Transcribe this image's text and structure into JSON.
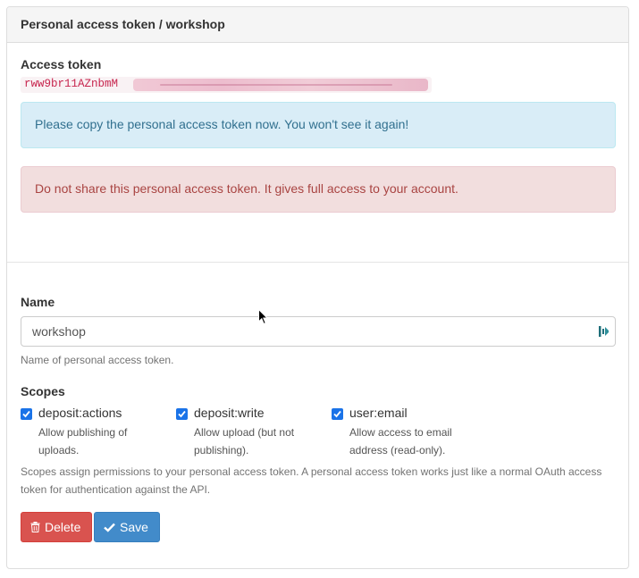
{
  "panel": {
    "title": "Personal access token / workshop"
  },
  "token": {
    "label": "Access token",
    "visible_prefix": "rww9br11AZnbmM"
  },
  "alerts": {
    "info": "Please copy the personal access token now. You won't see it again!",
    "danger": "Do not share this personal access token. It gives full access to your account."
  },
  "name_field": {
    "label": "Name",
    "value": "workshop",
    "help": "Name of personal access token."
  },
  "scopes": {
    "label": "Scopes",
    "items": [
      {
        "name": "deposit:actions",
        "desc": "Allow publishing of uploads.",
        "checked": true
      },
      {
        "name": "deposit:write",
        "desc": "Allow upload (but not publishing).",
        "checked": true
      },
      {
        "name": "user:email",
        "desc": "Allow access to email address (read-only).",
        "checked": true
      }
    ],
    "help": "Scopes assign permissions to your personal access token. A personal access token works just like a normal OAuth access token for authentication against the API."
  },
  "buttons": {
    "delete": "Delete",
    "save": "Save"
  },
  "colors": {
    "checkbox": "#1a73e8",
    "danger": "#d9534f",
    "primary": "#428bca"
  }
}
